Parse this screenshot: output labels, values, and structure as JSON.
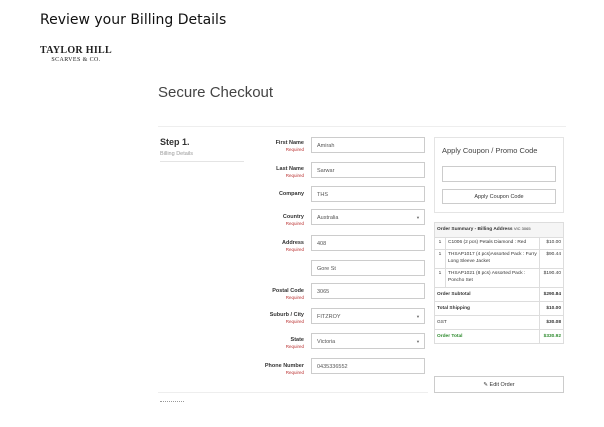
{
  "caption": "Review your Billing Details",
  "logo": {
    "line1": "TAYLOR HILL",
    "line2": "SCARVES & CO."
  },
  "page_title": "Secure Checkout",
  "step": {
    "title": "Step 1.",
    "subtitle": "Billing Details"
  },
  "required_label": "Required",
  "fields": {
    "first_name": {
      "label": "First Name",
      "value": "Amirah",
      "required": true
    },
    "last_name": {
      "label": "Last Name",
      "value": "Sarwar",
      "required": true
    },
    "company": {
      "label": "Company",
      "value": "THS"
    },
    "country": {
      "label": "Country",
      "value": "Australia",
      "required": true
    },
    "address": {
      "label": "Address",
      "line1": "408",
      "line2": "Gore St",
      "required": true
    },
    "postal_code": {
      "label": "Postal Code",
      "value": "3065",
      "required": true
    },
    "suburb": {
      "label": "Suburb / City",
      "value": "FITZROY",
      "required": true
    },
    "state": {
      "label": "State",
      "value": "Victoria",
      "required": true
    },
    "phone": {
      "label": "Phone Number",
      "value": "0435336552",
      "required": true
    }
  },
  "coupon": {
    "title": "Apply Coupon / Promo Code",
    "input_value": "",
    "button_label": "Apply Coupon Code"
  },
  "summary": {
    "title": "Order Summary - Billing Address",
    "title_suffix": "VIC 3065",
    "items": [
      {
        "qty": "1",
        "desc": "C1006 (2 pcs) Petals Diamond : Red",
        "price": "$10.00"
      },
      {
        "qty": "1",
        "desc": "THSAP1017 (4 pcs)Assorted Pack : Furry Long Sleeve Jacket",
        "price": "$90.44"
      },
      {
        "qty": "1",
        "desc": "THSAP1021 (8 pcs) Assorted Pack : Poncho Set",
        "price": "$190.40"
      }
    ],
    "subtotal": {
      "label": "Order Subtotal",
      "value": "$290.84"
    },
    "shipping": {
      "label": "Total Shipping",
      "value": "$10.00"
    },
    "gst": {
      "label": "GST",
      "value": "$30.08"
    },
    "total": {
      "label": "Order Total",
      "value": "$330.92"
    },
    "total_color": "#2e8b2e"
  },
  "edit_order_label": "Edit Order",
  "icons": {
    "edit": "pencil-icon",
    "dropdown": "caret-down-icon"
  }
}
